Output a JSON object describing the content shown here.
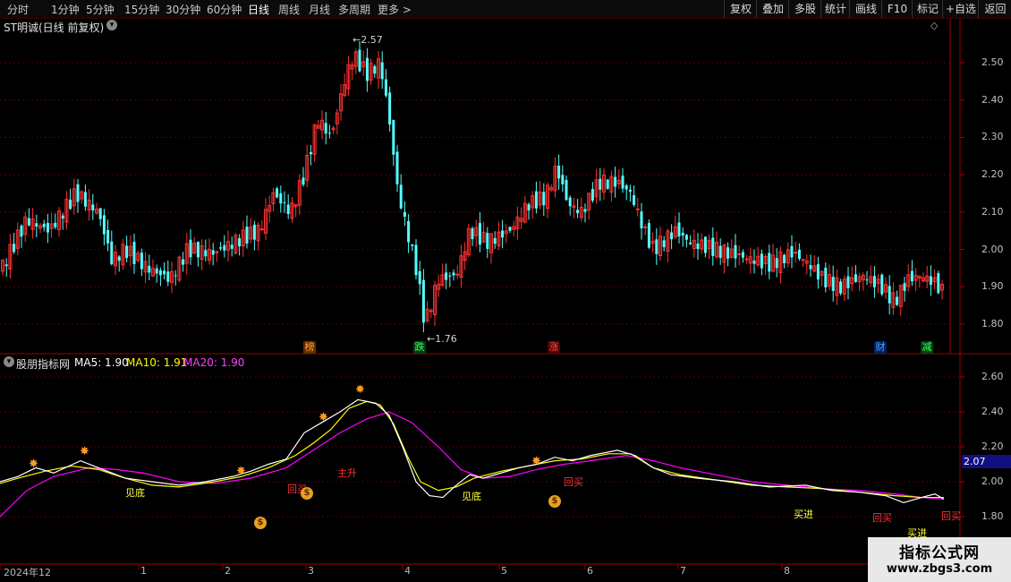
{
  "toolbar": {
    "periods": [
      "分时",
      "1分钟",
      "5分钟",
      "15分钟",
      "30分钟",
      "60分钟",
      "日线",
      "周线",
      "月线",
      "多周期"
    ],
    "active_period": "日线",
    "more_label": "更多 >",
    "right_buttons": [
      "复权",
      "叠加",
      "多股",
      "统计",
      "画线",
      "F10",
      "标记",
      "+自选",
      "返回"
    ]
  },
  "price_panel": {
    "stock_title": "ST明诚(日线 前复权)",
    "y_ticks": [
      "2.50",
      "2.40",
      "2.30",
      "2.20",
      "2.10",
      "2.00",
      "1.90",
      "1.80"
    ],
    "high_label": "2.57",
    "low_label": "1.76",
    "event_badges": [
      {
        "text": "榜",
        "color": "#e08020"
      },
      {
        "text": "跌",
        "color": "#20c040"
      },
      {
        "text": "涨",
        "color": "#e02020"
      },
      {
        "text": "财",
        "color": "#2080ff"
      },
      {
        "text": "减",
        "color": "#20c040"
      }
    ]
  },
  "indicator_panel": {
    "name": "股朋指标网",
    "ma5_label": "MA5: 1.90",
    "ma10_label": "MA10: 1.91",
    "ma20_label": "MA20: 1.90",
    "y_ticks": [
      "2.60",
      "2.40",
      "2.20",
      "2.00",
      "1.80"
    ],
    "current_value": "2.07",
    "signals": {
      "jiandi_1": "见底",
      "jiandi_2": "见底",
      "huimai_1": "回买",
      "huimai_2": "回买",
      "huimai_3": "回买",
      "huimai_4": "回买",
      "zhusheng": "主升",
      "maijin_1": "买进",
      "maijin_2": "买进"
    }
  },
  "date_axis": {
    "labels": [
      "2024年12",
      "1",
      "2",
      "3",
      "4",
      "5",
      "6",
      "7",
      "8"
    ]
  },
  "watermark": {
    "line1": "指标公式网",
    "line2": "www.zbgs3.com"
  },
  "colors": {
    "up": "#ff3232",
    "down": "#54ffff",
    "ma5": "#ffffff",
    "ma10": "#ffff00",
    "ma20": "#ff00ff",
    "grid": "#5a0000",
    "axis": "#a00000"
  }
}
